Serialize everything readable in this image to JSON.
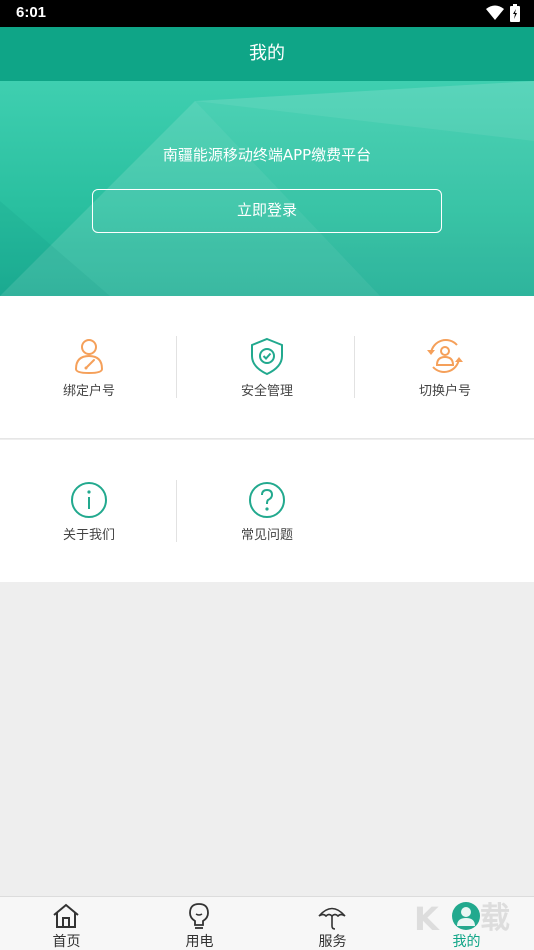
{
  "status_bar": {
    "time": "6:01"
  },
  "header": {
    "title": "我的"
  },
  "hero": {
    "subtitle": "南疆能源移动终端APP缴费平台",
    "login_label": "立即登录"
  },
  "menu_row1": [
    {
      "label": "绑定户号",
      "icon": "user-bind-icon"
    },
    {
      "label": "安全管理",
      "icon": "shield-icon"
    },
    {
      "label": "切换户号",
      "icon": "user-switch-icon"
    }
  ],
  "menu_row2": [
    {
      "label": "关于我们",
      "icon": "info-icon"
    },
    {
      "label": "常见问题",
      "icon": "question-icon"
    }
  ],
  "tabbar": {
    "items": [
      {
        "label": "首页",
        "icon": "home-icon"
      },
      {
        "label": "用电",
        "icon": "lightbulb-icon"
      },
      {
        "label": "服务",
        "icon": "umbrella-icon"
      },
      {
        "label": "我的",
        "icon": "profile-icon",
        "active": true
      }
    ]
  },
  "colors": {
    "primary": "#0fa587",
    "orange": "#f5a05a",
    "teal_icon": "#22a98e"
  }
}
